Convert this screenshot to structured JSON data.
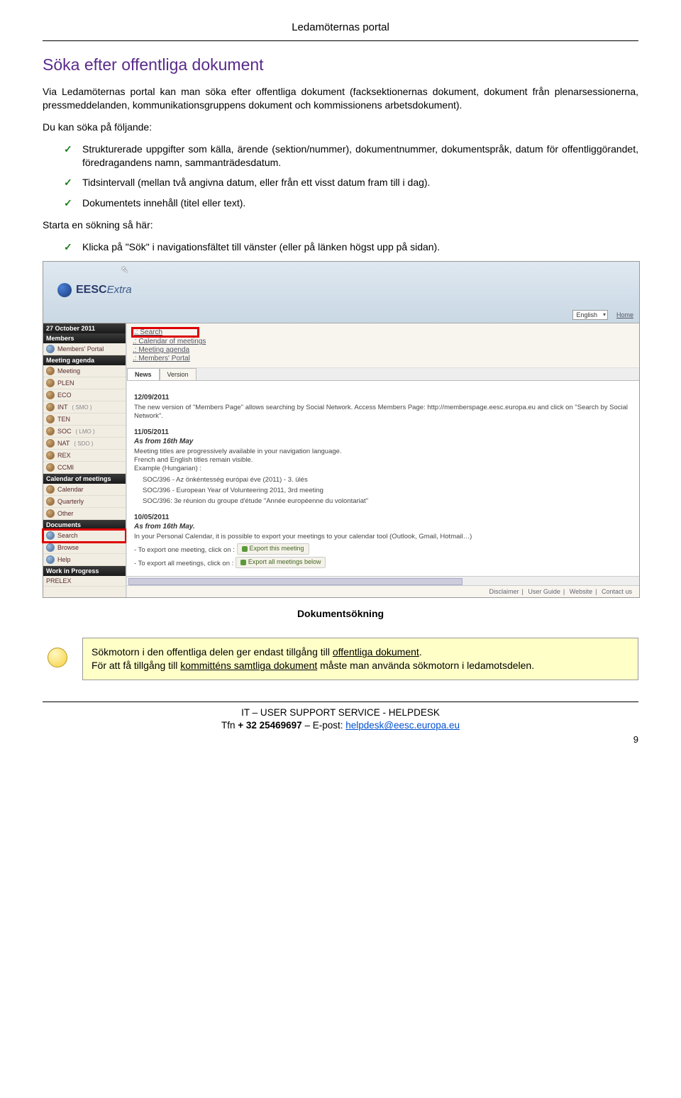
{
  "header_title": "Ledamöternas portal",
  "section_title": "Söka efter offentliga dokument",
  "intro": "Via Ledamöternas portal kan man söka efter offentliga dokument (facksektionernas dokument, dokument från plenarsessionerna, pressmeddelanden, kommunikationsgruppens dokument och kommissionens arbetsdokument).",
  "sub1": "Du kan söka på följande:",
  "bullets1": [
    "Strukturerade uppgifter som källa, ärende (sektion/nummer), dokumentnummer, dokumentspråk, datum för offentliggörandet, föredragandens namn, sammanträdesdatum.",
    "Tidsintervall (mellan två angivna datum, eller från ett visst datum fram till i dag).",
    "Dokumentets innehåll (titel eller text)."
  ],
  "sub2": "Starta en sökning så här:",
  "bullets2": [
    "Klicka på \"Sök\" i navigationsfältet till vänster (eller på länken högst upp på sidan)."
  ],
  "screenshot": {
    "logo": "EESC",
    "logo_suffix": "Extra",
    "lang": "English",
    "home": "Home",
    "sidebar": {
      "date": "27 October 2011",
      "sections": [
        {
          "title": "Members",
          "items": [
            {
              "label": "Members' Portal"
            }
          ]
        },
        {
          "title": "Meeting agenda",
          "items": [
            {
              "label": "Meeting"
            },
            {
              "label": "PLEN"
            },
            {
              "label": "ECO"
            },
            {
              "label": "INT",
              "sub": "( SMO )"
            },
            {
              "label": "TEN"
            },
            {
              "label": "SOC",
              "sub": "( LMO )"
            },
            {
              "label": "NAT",
              "sub": "( SDO )"
            },
            {
              "label": "REX"
            },
            {
              "label": "CCMI"
            }
          ]
        },
        {
          "title": "Calendar of meetings",
          "items": [
            {
              "label": "Calendar"
            },
            {
              "label": "Quarterly"
            },
            {
              "label": "Other"
            }
          ]
        },
        {
          "title": "Documents",
          "items": [
            {
              "label": "Search",
              "highlight": true
            },
            {
              "label": "Browse"
            },
            {
              "label": "Help"
            }
          ]
        },
        {
          "title": "Work in Progress",
          "items": [
            {
              "label": "PRELEX"
            }
          ]
        }
      ]
    },
    "quick_links": [
      ".: Search",
      ".: Calendar of meetings",
      ".: Meeting agenda",
      ".: Members' Portal"
    ],
    "tabs": [
      "News",
      "Version"
    ],
    "news": [
      {
        "date": "12/09/2011",
        "body": "The new version of \"Members Page\" allows searching by Social Network. Access Members Page: http://memberspage.eesc.europa.eu and click on \"Search by Social Network\"."
      },
      {
        "date": "11/05/2011",
        "sub": "As from 16th May",
        "body": "Meeting titles are progressively available in your navigation language.\nFrench and English titles remain visible.\nExample (Hungarian) :",
        "examples": [
          "SOC/396 - Az önkéntesség európai éve (2011) - 3. ülés",
          "SOC/396 - European Year of Volunteering 2011, 3rd meeting",
          "SOC/396: 3e réunion du groupe d'étude \"Année européenne du volontariat\""
        ]
      },
      {
        "date": "10/05/2011",
        "sub": "As from 16th May.",
        "body": "In your Personal Calendar, it is possible to export your meetings to your calendar tool (Outlook, Gmail, Hotmail…)",
        "export1": "- To export one meeting, click on :",
        "export_btn1": "Export this meeting",
        "export2": "- To export all meetings, click on :",
        "export_btn2": "Export all meetings below"
      }
    ],
    "footer_links": [
      "Disclaimer",
      "User Guide",
      "Website",
      "Contact us"
    ]
  },
  "caption": "Dokumentsökning",
  "tip_line1a": "Sökmotorn i den offentliga delen ger endast tillgång till ",
  "tip_line1b": "offentliga dokument",
  "tip_line2a": "För att få tillgång till ",
  "tip_line2b": "kommitténs samtliga dokument",
  "tip_line2c": " måste man använda sökmotorn i ledamotsdelen.",
  "footer": {
    "line1a": "IT – U",
    "line1b": "SER ",
    "line1c": "S",
    "line1d": "UPPORT ",
    "line1e": "S",
    "line1f": "ERVICE",
    "line1g": " - H",
    "line1h": "ELPDESK",
    "line2a": "Tfn ",
    "line2b": "+ 32 25469697",
    "line2c": " – E-post: ",
    "email": "helpdesk@eesc.europa.eu"
  },
  "page_number": "9"
}
